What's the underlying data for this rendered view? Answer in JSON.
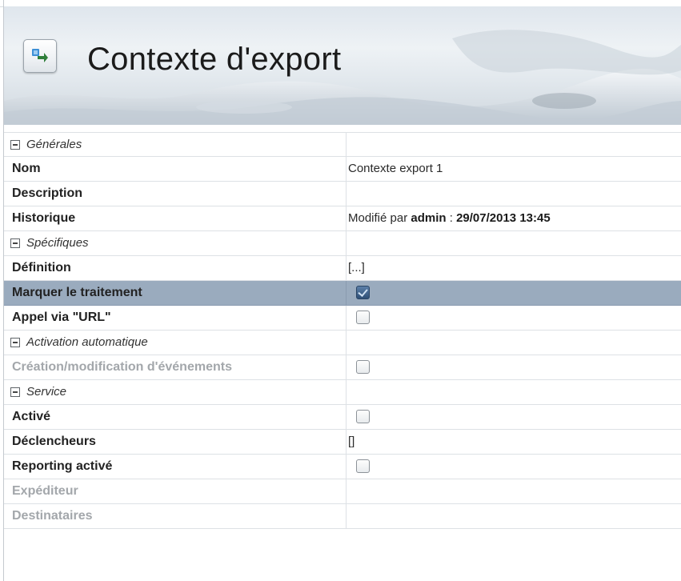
{
  "header": {
    "title": "Contexte d'export",
    "icon": "export-context-icon"
  },
  "colors": {
    "selected_row": "#9aabbe",
    "disabled_text": "#a3a7ab",
    "checkbox_checked": "#2e4f76"
  },
  "sections": {
    "generales": "Générales",
    "specifiques": "Spécifiques",
    "activation": "Activation automatique",
    "service": "Service"
  },
  "fields": {
    "nom": {
      "label": "Nom",
      "value": "Contexte export 1"
    },
    "description": {
      "label": "Description",
      "value": ""
    },
    "historique": {
      "label": "Historique",
      "prefix": "Modifié par ",
      "user": "admin",
      "separator": " : ",
      "date": "29/07/2013 13:45"
    },
    "definition": {
      "label": "Définition",
      "value": "[...]"
    },
    "marquer": {
      "label": "Marquer le traitement",
      "checked": true
    },
    "appel_url": {
      "label": "Appel via \"URL\"",
      "checked": false
    },
    "creation_modif": {
      "label": "Création/modification d'événements",
      "checked": false
    },
    "active": {
      "label": "Activé",
      "checked": false
    },
    "declencheurs": {
      "label": "Déclencheurs",
      "value": "[]"
    },
    "reporting": {
      "label": "Reporting activé",
      "checked": false
    },
    "expediteur": {
      "label": "Expéditeur",
      "value": ""
    },
    "destinataires": {
      "label": "Destinataires",
      "value": ""
    }
  }
}
